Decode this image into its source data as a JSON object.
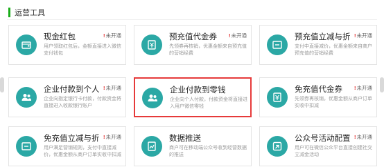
{
  "section": {
    "title": "运营工具"
  },
  "status_label": "未开通",
  "status_mark": "!",
  "cards": [
    {
      "title": "现金红包",
      "desc": "用户领取红包后，金额直接进入微信支付钱包",
      "icon": "wallet-icon"
    },
    {
      "title": "预充值代金券",
      "desc": "先领券再核销，优惠金额来自预充值的营销经费",
      "icon": "coupon-icon"
    },
    {
      "title": "预充值立减与折扣",
      "desc": "支付中直接减价，优惠金额来自商户预充值的营销经费",
      "icon": "discount-icon"
    },
    {
      "title": "企业付款到个人银...",
      "desc": "企业向指定银行卡付款，付款资金将直接进入收款银行账户",
      "icon": "users-icon"
    },
    {
      "title": "企业付款到零钱",
      "desc": "企业向个人付款，付款资金将直接进入用户微信零钱",
      "icon": "users-icon"
    },
    {
      "title": "免充值代金券",
      "desc": "先领券再核销，优惠金额从商户订单实收中扣减",
      "icon": "coupon-icon"
    },
    {
      "title": "免充值立减与折扣",
      "desc": "用户满足营销规则，支付中直接减价，优惠金额从商户订单实收中扣减",
      "icon": "discount-icon"
    },
    {
      "title": "数据推送",
      "desc": "商户可在移动端公众号收到经营数据的推送",
      "icon": "chart-icon"
    },
    {
      "title": "公众号活动配置",
      "desc": "用户可在微信公众平台直接创建社交立减金活动",
      "icon": "share-icon"
    }
  ]
}
